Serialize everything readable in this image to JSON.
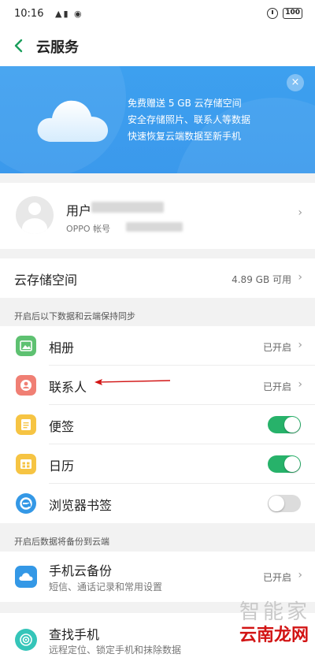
{
  "status_bar": {
    "time": "10:16",
    "left_icons": "▲▮ ◉",
    "battery": "100",
    "icons": [
      "signal-icon",
      "wifi-icon",
      "alarm-icon",
      "battery-icon"
    ]
  },
  "nav": {
    "title": "云服务"
  },
  "banner": {
    "lines": [
      "免费赠送 5 GB 云存储空间",
      "安全存储照片、联系人等数据",
      "快速恢复云端数据至新手机"
    ],
    "close": "×",
    "color": "#3b9cee"
  },
  "account": {
    "name": "用户",
    "sub": "OPPO 帐号"
  },
  "storage": {
    "title": "云存储空间",
    "value": "4.89 GB 可用"
  },
  "sync_section": {
    "label": "开启后以下数据和云端保持同步",
    "items": [
      {
        "title": "相册",
        "status": "已开启",
        "icon": "photo-icon"
      },
      {
        "title": "联系人",
        "status": "已开启",
        "icon": "contact-icon"
      },
      {
        "title": "便签",
        "toggle": true,
        "icon": "note-icon"
      },
      {
        "title": "日历",
        "toggle": true,
        "icon": "calendar-icon"
      },
      {
        "title": "浏览器书签",
        "toggle": false,
        "icon": "browser-icon"
      }
    ]
  },
  "backup_section": {
    "label": "开启后数据将备份到云端",
    "backup": {
      "title": "手机云备份",
      "sub": "短信、通话记录和常用设置",
      "status": "已开启"
    },
    "find": {
      "title": "查找手机",
      "sub": "远程定位、锁定手机和抹除数据"
    }
  },
  "chevron": "›",
  "watermark": {
    "top": "智能家",
    "bottom": "云南龙网"
  },
  "colors": {
    "accent": "#27b26a",
    "banner": "#3b9cee",
    "arrow": "#d21414"
  }
}
